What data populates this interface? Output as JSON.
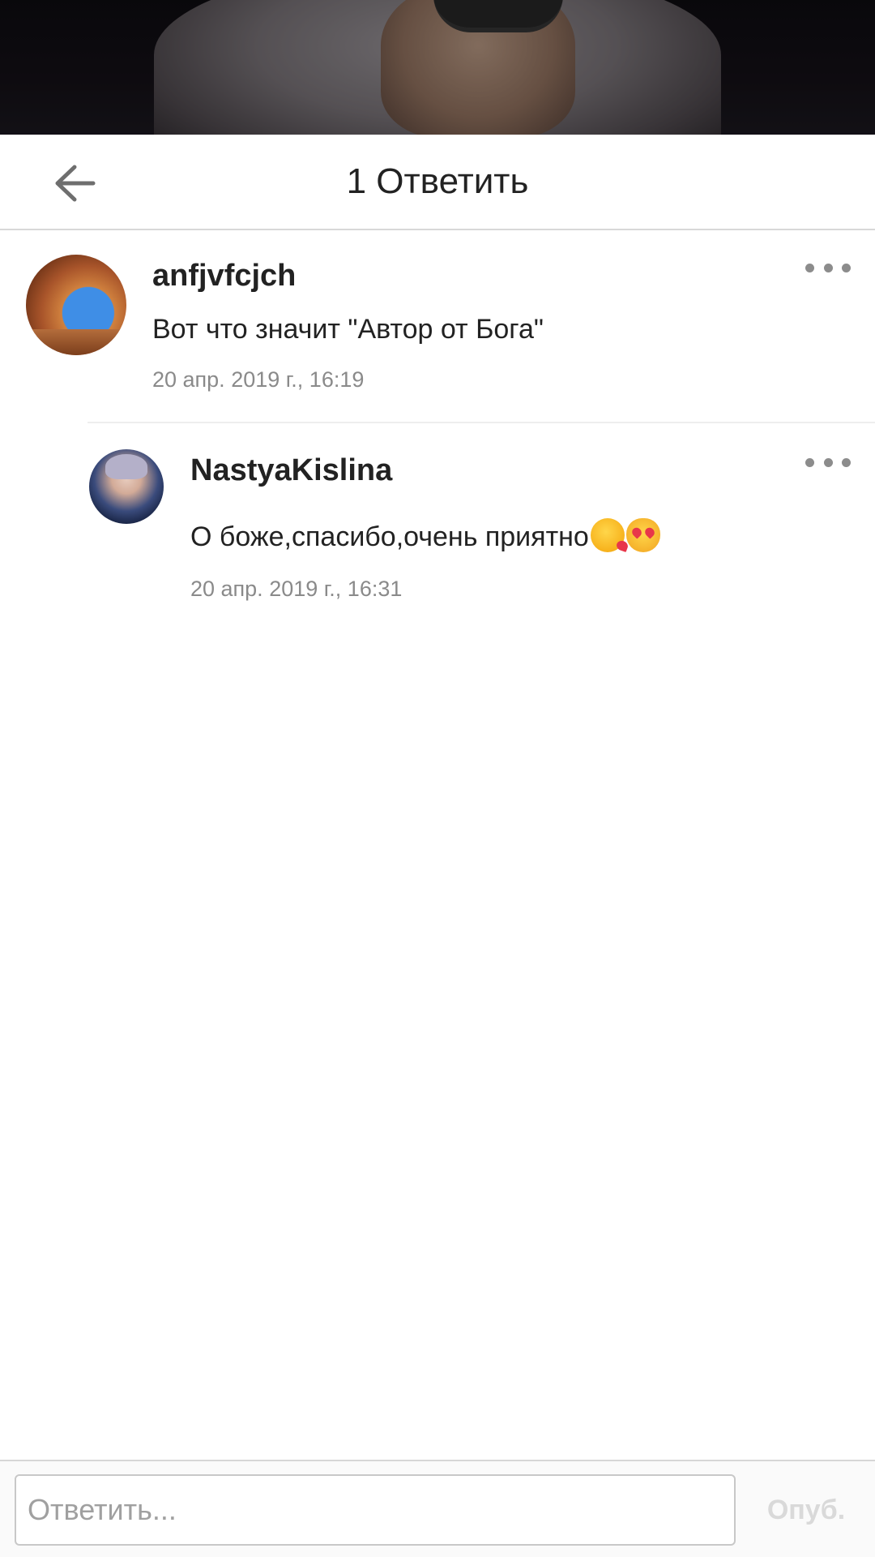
{
  "header": {
    "title": "1 Ответить",
    "back_icon": "arrow-left-icon"
  },
  "comments": [
    {
      "username": "anfjvfcjch",
      "message": "Вот что значит \"Автор от Бога\"",
      "timestamp": "20 апр. 2019 г., 16:19",
      "avatar": "arch-landscape-avatar",
      "more_icon": "more-horizontal-icon"
    },
    {
      "username": "NastyaKislina",
      "message": "О боже,спасибо,очень приятно",
      "emojis": [
        "face-blowing-kiss-emoji",
        "heart-eyes-cat-emoji"
      ],
      "timestamp": "20 апр. 2019 г., 16:31",
      "avatar": "portrait-avatar",
      "more_icon": "more-horizontal-icon"
    }
  ],
  "reply_bar": {
    "placeholder": "Ответить...",
    "value": "",
    "publish_label": "Опуб."
  },
  "colors": {
    "text": "#222222",
    "muted": "#8a8a8a",
    "divider": "#d8d8d8",
    "publish_disabled": "#d9d9d9"
  }
}
